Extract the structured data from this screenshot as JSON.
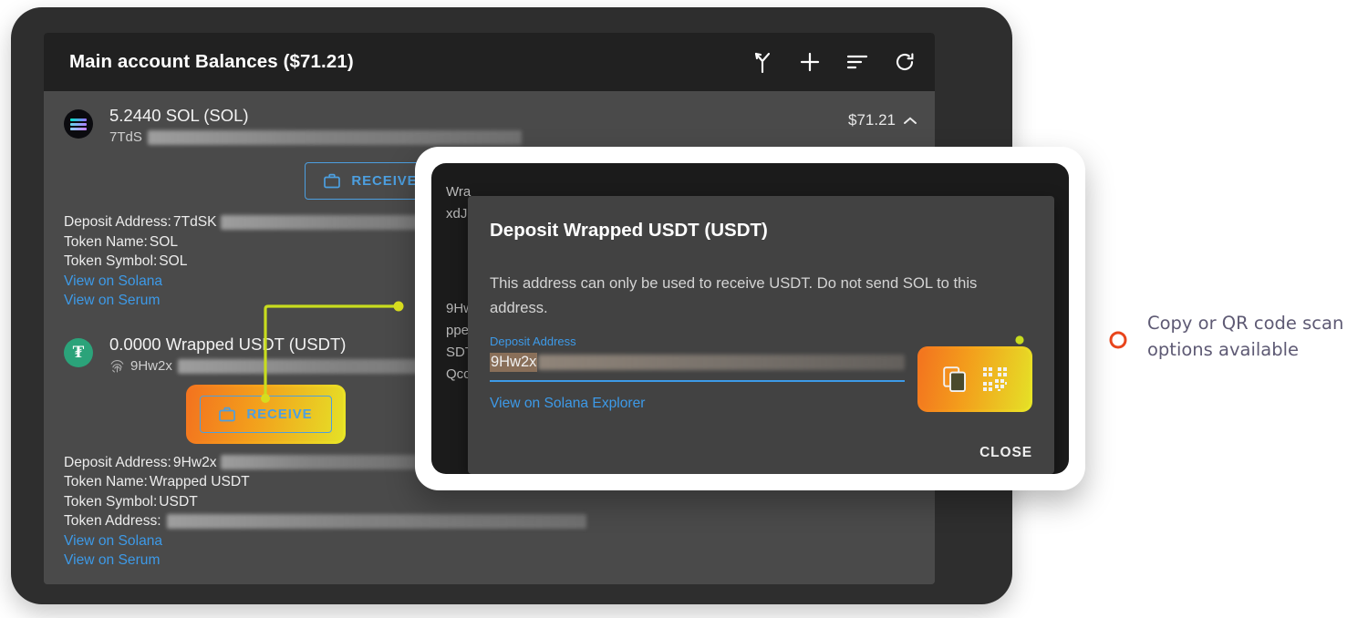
{
  "app": {
    "header": {
      "title": "Main account Balances ($71.21)",
      "icons": [
        {
          "name": "call-merge-icon",
          "label": "Merge"
        },
        {
          "name": "add-icon",
          "label": "Add"
        },
        {
          "name": "sort-icon",
          "label": "Sort"
        },
        {
          "name": "refresh-icon",
          "label": "Refresh"
        }
      ]
    },
    "rows": [
      {
        "icon": "solana-coin-icon",
        "amount": "5.2440 SOL (SOL)",
        "address_visible": "7TdS",
        "value": "$71.21",
        "chevron": "chevron-up-icon",
        "receive_label": "RECEIVE",
        "details": [
          {
            "label": "Deposit Address: ",
            "value": "7TdSK",
            "blurred": true
          },
          {
            "label": "Token Name: ",
            "value": "SOL",
            "blurred": false
          },
          {
            "label": "Token Symbol: ",
            "value": "SOL",
            "blurred": false
          }
        ],
        "links": [
          "View on Solana",
          "View on Serum"
        ]
      },
      {
        "icon": "tether-coin-icon",
        "amount": "0.0000 Wrapped USDT (USDT)",
        "address_visible": "9Hw2x",
        "value": "",
        "chevron": "",
        "receive_label": "RECEIVE",
        "details": [
          {
            "label": "Deposit Address: ",
            "value": "9Hw2x",
            "blurred": true
          },
          {
            "label": "Token Name: ",
            "value": "Wrapped USDT",
            "blurred": false
          },
          {
            "label": "Token Symbol: ",
            "value": "USDT",
            "blurred": false
          },
          {
            "label": "Token Address: ",
            "value": "",
            "blurred": true
          }
        ],
        "links": [
          "View on Solana",
          "View on Serum"
        ]
      }
    ]
  },
  "background_ghost_text": [
    "Wra",
    "xdJ",
    "9Hw",
    "ppe",
    "SDT",
    "Qcc"
  ],
  "modal": {
    "title": "Deposit Wrapped USDT (USDT)",
    "body": "This address can only be used to receive USDT. Do not send SOL to this address.",
    "field_label": "Deposit Address",
    "field_value_visible": "9Hw2x",
    "explorer_link": "View on Solana Explorer",
    "close_label": "CLOSE",
    "actions": [
      {
        "name": "copy-icon",
        "label": "Copy"
      },
      {
        "name": "qr-code-icon",
        "label": "QR code"
      }
    ]
  },
  "annotation": {
    "text": "Copy or QR code scan options available",
    "color": "#5e5a74"
  },
  "colors": {
    "accent_blue": "#3d9ae8",
    "highlight_start": "#f4731f",
    "highlight_end": "#e8e827",
    "connector_yellow": "#d7e02a",
    "connector_orange": "#e8471f",
    "usdt_green": "#2ba37a"
  }
}
